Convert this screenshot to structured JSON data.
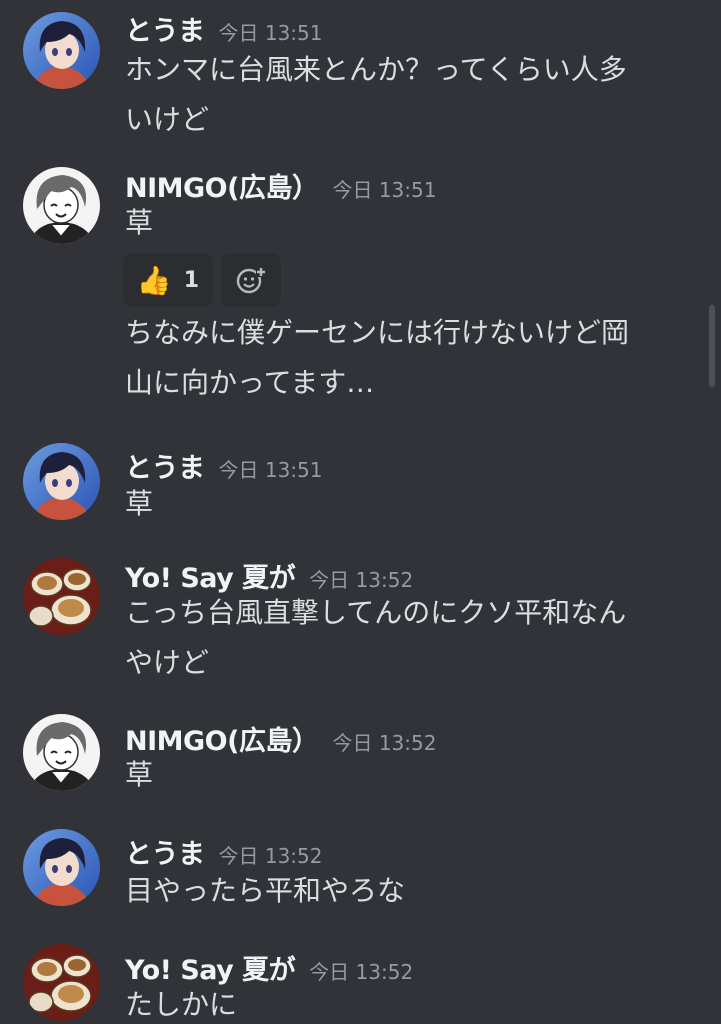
{
  "messages": [
    {
      "author": "とうま",
      "avatar": "toma-avatar-icon",
      "timestamp": "今日 13:51",
      "lines": [
        "ホンマに台風来とんか？ってくらい人多",
        "いけど"
      ]
    },
    {
      "author": "NIMGO(広島）",
      "avatar": "nimgo-avatar-icon",
      "timestamp": "今日 13:51",
      "lines": [
        "草"
      ],
      "reaction": {
        "emoji": "👍",
        "icon": "thumbs-up-icon",
        "count": "1"
      },
      "add_reaction_icon": "add-reaction-icon",
      "followup_lines": [
        "ちなみに僕ゲーセンには行けないけど岡",
        "山に向かってます…"
      ]
    },
    {
      "author": "とうま",
      "avatar": "toma-avatar-icon",
      "timestamp": "今日 13:51",
      "lines": [
        "草"
      ]
    },
    {
      "author": "Yo! Say 夏が",
      "avatar": "yosay-avatar-icon",
      "timestamp": "今日 13:52",
      "lines": [
        "こっち台風直撃してんのにクソ平和なん",
        "やけど"
      ]
    },
    {
      "author": "NIMGO(広島）",
      "avatar": "nimgo-avatar-icon",
      "timestamp": "今日 13:52",
      "lines": [
        "草"
      ]
    },
    {
      "author": "とうま",
      "avatar": "toma-avatar-icon",
      "timestamp": "今日 13:52",
      "lines": [
        "目やったら平和やろな"
      ]
    },
    {
      "author": "Yo! Say 夏が",
      "avatar": "yosay-avatar-icon",
      "timestamp": "今日 13:52",
      "lines": [
        "たしかに"
      ]
    }
  ],
  "colors": {
    "background": "#313338",
    "author_name": "#f2f3f5",
    "timestamp": "#949ba4",
    "message_text": "#dbdee1",
    "reaction_bg": "#2b2d31"
  }
}
